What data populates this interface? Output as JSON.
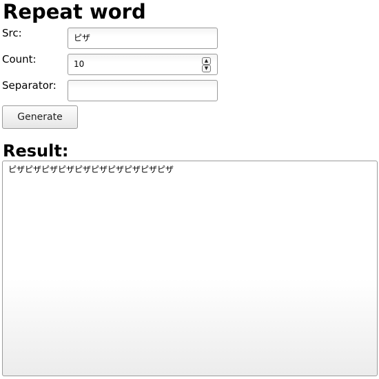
{
  "title": "Repeat word",
  "form": {
    "src_label": "Src:",
    "src_value": "ピザ",
    "count_label": "Count:",
    "count_value": "10",
    "separator_label": "Separator:",
    "separator_value": "",
    "generate_label": "Generate"
  },
  "result": {
    "heading": "Result:",
    "text": "ピザピザピザピザピザピザピザピザピザピザ"
  }
}
